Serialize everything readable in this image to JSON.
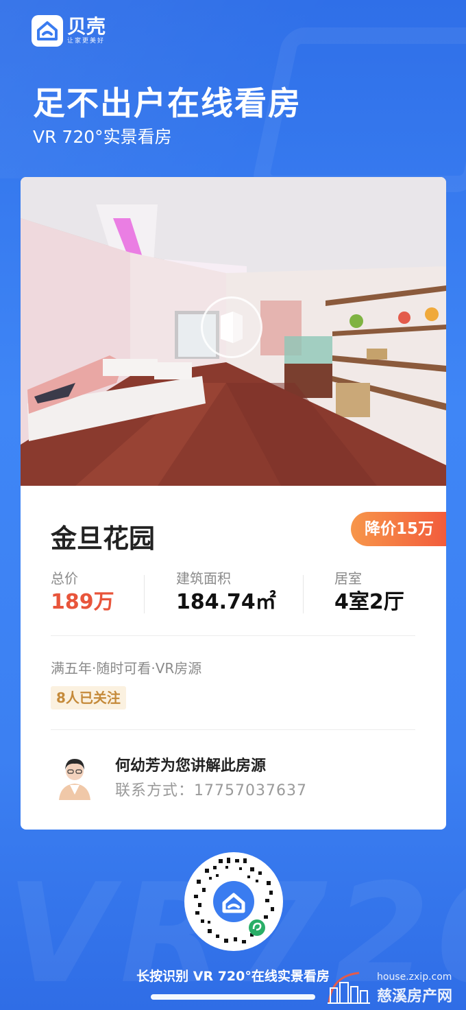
{
  "brand": {
    "name": "贝壳",
    "slogan": "让家更美好"
  },
  "hero": {
    "headline": "足不出户在线看房",
    "subline": "VR 720°实景看房"
  },
  "listing": {
    "title": "金旦花园",
    "price_cut_badge": "降价15万",
    "stats": [
      {
        "label": "总价",
        "value": "189万"
      },
      {
        "label": "建筑面积",
        "value": "184.74㎡"
      },
      {
        "label": "居室",
        "value": "4室2厅"
      }
    ],
    "tags": "满五年·随时可看·VR房源",
    "followers": "8人已关注"
  },
  "agent": {
    "title": "何幼芳为您讲解此房源",
    "contact": "联系方式：17757037637"
  },
  "qr": {
    "caption": "长按识别 VR 720°在线实景看房"
  },
  "watermark": {
    "url": "house.zxip.com",
    "name": "慈溪房产网"
  },
  "colors": {
    "background": "#3a7cf0",
    "price_red": "#e8553b",
    "badge_orange": "#f25c3c",
    "follow_bg": "#fbf1e0",
    "follow_text": "#c58a3a"
  },
  "icons": [
    "beike-logo-icon",
    "vr-play-icon",
    "agent-avatar",
    "mini-program-qr-code",
    "wechat-mini-program-icon",
    "watermark-building-icon"
  ]
}
